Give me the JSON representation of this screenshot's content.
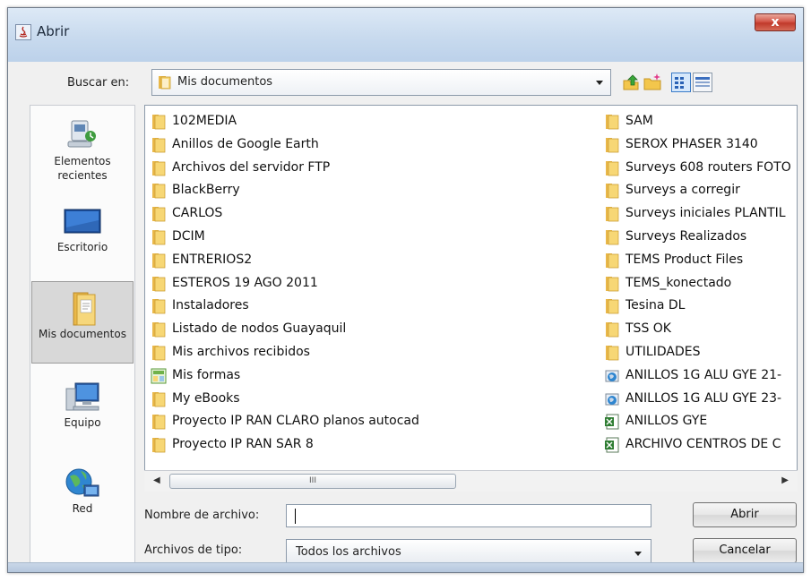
{
  "window": {
    "title": "Abrir",
    "close_label": "x"
  },
  "lookin": {
    "label": "Buscar en:",
    "value": "Mis documentos"
  },
  "places": [
    {
      "label": "Elementos recientes",
      "icon": "recent-items-icon"
    },
    {
      "label": "Escritorio",
      "icon": "desktop-icon"
    },
    {
      "label": "Mis documentos",
      "icon": "my-documents-icon",
      "selected": true
    },
    {
      "label": "Equipo",
      "icon": "computer-icon"
    },
    {
      "label": "Red",
      "icon": "network-icon"
    }
  ],
  "files_col1": [
    {
      "name": "102MEDIA",
      "type": "folder"
    },
    {
      "name": "Anillos de Google Earth",
      "type": "folder"
    },
    {
      "name": "Archivos del servidor FTP",
      "type": "folder"
    },
    {
      "name": "BlackBerry",
      "type": "folder"
    },
    {
      "name": "CARLOS",
      "type": "folder"
    },
    {
      "name": "DCIM",
      "type": "folder"
    },
    {
      "name": "ENTRERIOS2",
      "type": "folder"
    },
    {
      "name": "ESTEROS 19 AGO 2011",
      "type": "folder"
    },
    {
      "name": "Instaladores",
      "type": "folder"
    },
    {
      "name": "Listado de nodos Guayaquil",
      "type": "folder"
    },
    {
      "name": "Mis archivos recibidos",
      "type": "folder"
    },
    {
      "name": "Mis formas",
      "type": "special"
    },
    {
      "name": "My eBooks",
      "type": "folder"
    },
    {
      "name": "Proyecto IP RAN CLARO planos autocad",
      "type": "folder"
    },
    {
      "name": "Proyecto IP RAN SAR 8",
      "type": "folder"
    }
  ],
  "files_col2": [
    {
      "name": "SAM",
      "type": "folder"
    },
    {
      "name": "SEROX PHASER 3140",
      "type": "folder"
    },
    {
      "name": "Surveys 608 routers FOTO",
      "type": "folder"
    },
    {
      "name": "Surveys a corregir",
      "type": "folder"
    },
    {
      "name": "Surveys iniciales PLANTIL",
      "type": "folder"
    },
    {
      "name": "Surveys Realizados",
      "type": "folder"
    },
    {
      "name": "TEMS Product Files",
      "type": "folder"
    },
    {
      "name": "TEMS_konectado",
      "type": "folder"
    },
    {
      "name": "Tesina DL",
      "type": "folder"
    },
    {
      "name": "TSS OK",
      "type": "folder"
    },
    {
      "name": "UTILIDADES",
      "type": "folder"
    },
    {
      "name": "ANILLOS 1G ALU GYE 21-",
      "type": "globe"
    },
    {
      "name": "ANILLOS 1G ALU GYE 23-",
      "type": "globe"
    },
    {
      "name": "ANILLOS GYE",
      "type": "excel"
    },
    {
      "name": "ARCHIVO CENTROS DE C",
      "type": "excel"
    }
  ],
  "scrollbar": {
    "thumb_label": "III"
  },
  "filename": {
    "label": "Nombre de archivo:",
    "value": ""
  },
  "filetype": {
    "label": "Archivos de tipo:",
    "value": "Todos los archivos"
  },
  "buttons": {
    "open": "Abrir",
    "cancel": "Cancelar"
  }
}
